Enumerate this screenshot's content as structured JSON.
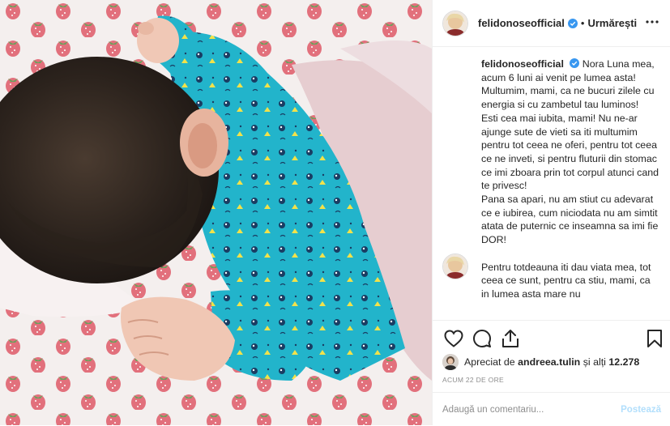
{
  "header": {
    "username": "felidonoseofficial",
    "dot": "•",
    "follow_label": "Urmărești"
  },
  "caption": {
    "username": "felidonoseofficial",
    "paragraphs": [
      "Nora Luna mea, acum 6 luni ai venit pe lumea asta! Multumim, mami, ca ne bucuri zilele cu energia si cu zambetul tau luminos!",
      "Esti cea mai iubita, mami! Nu ne-ar ajunge sute de vieti sa iti multumim pentru tot ceea ne oferi, pentru tot ceea ce ne inveti, si pentru fluturii din stomac ce imi zboara prin tot corpul atunci cand te privesc!",
      "Pana sa apari, nu am stiut cu adevarat ce e iubirea, cum niciodata nu am simtit atata de puternic ce inseamna sa imi fie DOR!",
      "Pentru totdeauna iti dau viata mea, tot ceea ce sunt, pentru ca stiu, mami, ca in lumea asta mare nu"
    ]
  },
  "likes": {
    "prefix": "Apreciat de ",
    "first_liker": "andreea.tulin",
    "middle": " și alți ",
    "count": "12.278"
  },
  "timestamp": "ACUM 22 DE ORE",
  "add_comment": {
    "placeholder": "Adaugă un comentariu...",
    "post_label": "Postează"
  },
  "icons": {
    "like": "heart-icon",
    "comment": "comment-icon",
    "share": "share-icon",
    "save": "bookmark-icon",
    "more": "more-options-icon",
    "verified": "verified-badge-icon"
  },
  "colors": {
    "verified_blue": "#3897f0",
    "post_button_disabled": "#b2dffc",
    "muted_text": "#8e8e8e",
    "onesie_teal": "#1fb3c9"
  }
}
